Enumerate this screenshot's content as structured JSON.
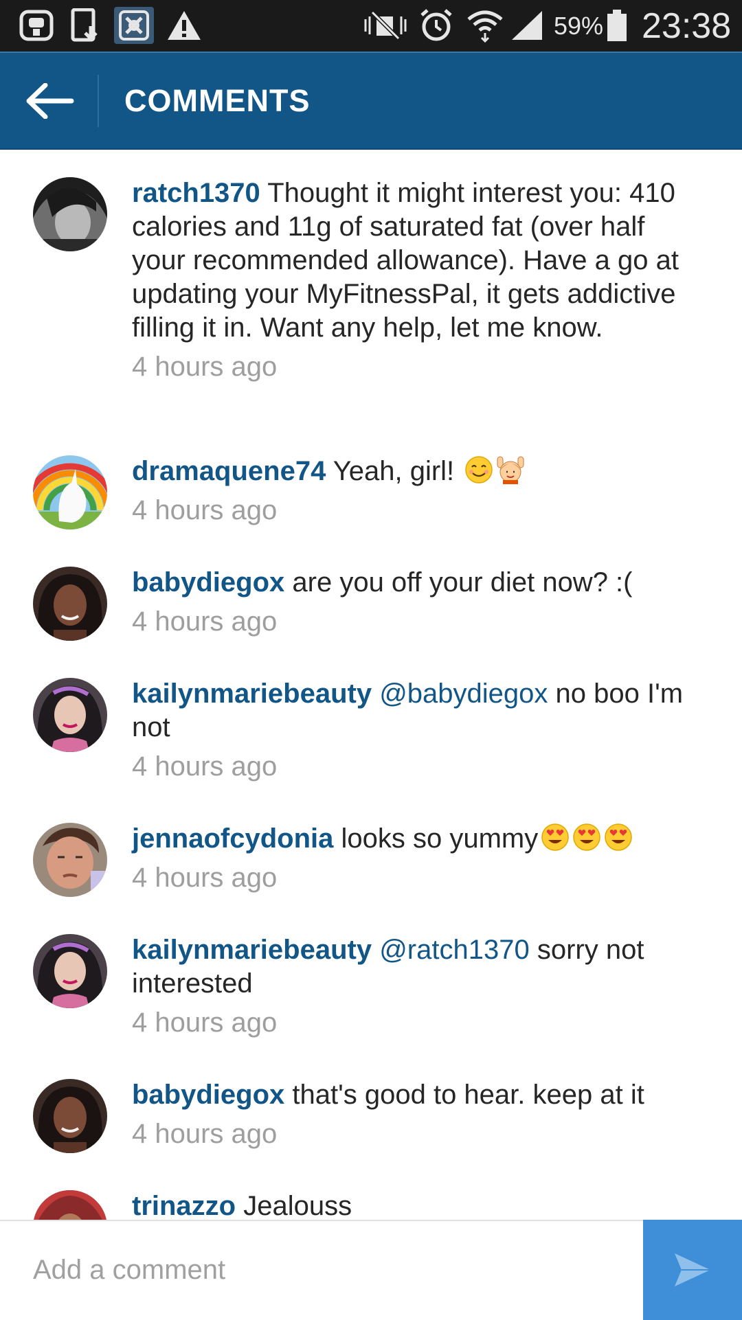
{
  "status_bar": {
    "battery": "59%",
    "time": "23:38",
    "icons": [
      "voicemail-icon",
      "phone-download-icon",
      "screen-capture-icon",
      "warning-icon",
      "mute-icon",
      "alarm-icon",
      "wifi-icon",
      "signal-icon",
      "battery-icon"
    ]
  },
  "header": {
    "back_icon": "arrow-left-icon",
    "title": "COMMENTS"
  },
  "comments": [
    {
      "username": "ratch1370",
      "mention": "",
      "text": "Thought it might interest you: 410 calories and 11g of saturated fat (over half your recommended allowance). Have a go at updating your MyFitnessPal, it gets addictive filling it in. Want any help, let me know.",
      "time": "4 hours ago"
    },
    {
      "username": "dramaquene74",
      "mention": "",
      "text": "Yeah, girl!",
      "emojis": [
        "smiling-face-emoji",
        "person-raising-hands-emoji"
      ],
      "time": "4 hours ago"
    },
    {
      "username": "babydiegox",
      "mention": "",
      "text": "are you off your diet now? :(",
      "time": "4 hours ago"
    },
    {
      "username": "kailynmariebeauty",
      "mention": "@babydiegox",
      "text": "no boo I'm not",
      "time": "4 hours ago"
    },
    {
      "username": "jennaofcydonia",
      "mention": "",
      "text": "looks so yummy",
      "emojis": [
        "heart-eyes-emoji",
        "heart-eyes-emoji",
        "heart-eyes-emoji"
      ],
      "time": "4 hours ago"
    },
    {
      "username": "kailynmariebeauty",
      "mention": "@ratch1370",
      "text": "sorry not interested",
      "time": "4 hours ago"
    },
    {
      "username": "babydiegox",
      "mention": "",
      "text": "that's good to hear. keep at it",
      "time": "4 hours ago"
    },
    {
      "username": "trinazzo",
      "mention": "",
      "text": "Jealouss",
      "time": ""
    }
  ],
  "composer": {
    "placeholder": "Add a comment",
    "send_icon": "send-arrow-icon"
  },
  "colors": {
    "header_bg": "#125688",
    "username": "#125688",
    "send_button": "#3f8ed8",
    "timestamp": "#9e9e9e"
  }
}
